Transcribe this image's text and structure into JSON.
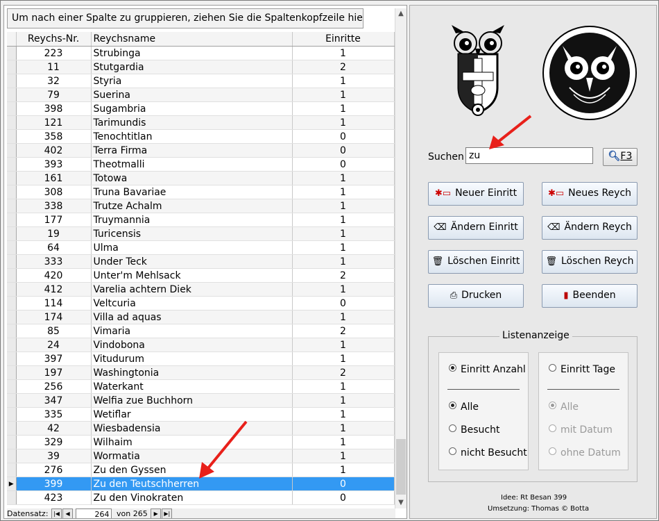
{
  "grid": {
    "group_bar_text": "Um nach einer Spalte zu gruppieren, ziehen Sie die Spaltenkopfzeile hierher.",
    "columns": [
      "Reychs-Nr.",
      "Reychsname",
      "Einritte"
    ],
    "rows": [
      {
        "nr": "223",
        "name": "Strubinga",
        "einritte": "1"
      },
      {
        "nr": "11",
        "name": "Stutgardia",
        "einritte": "2"
      },
      {
        "nr": "32",
        "name": "Styria",
        "einritte": "1"
      },
      {
        "nr": "79",
        "name": "Suerina",
        "einritte": "1"
      },
      {
        "nr": "398",
        "name": "Sugambria",
        "einritte": "1"
      },
      {
        "nr": "121",
        "name": "Tarimundis",
        "einritte": "1"
      },
      {
        "nr": "358",
        "name": "Tenochtitlan",
        "einritte": "0"
      },
      {
        "nr": "402",
        "name": "Terra Firma",
        "einritte": "0"
      },
      {
        "nr": "393",
        "name": "Theotmalli",
        "einritte": "0"
      },
      {
        "nr": "161",
        "name": "Totowa",
        "einritte": "1"
      },
      {
        "nr": "308",
        "name": "Truna Bavariae",
        "einritte": "1"
      },
      {
        "nr": "338",
        "name": "Trutze Achalm",
        "einritte": "1"
      },
      {
        "nr": "177",
        "name": "Truymannia",
        "einritte": "1"
      },
      {
        "nr": "19",
        "name": "Turicensis",
        "einritte": "1"
      },
      {
        "nr": "64",
        "name": "Ulma",
        "einritte": "1"
      },
      {
        "nr": "333",
        "name": "Under Teck",
        "einritte": "1"
      },
      {
        "nr": "420",
        "name": "Unter'm Mehlsack",
        "einritte": "2"
      },
      {
        "nr": "412",
        "name": "Varelia achtern Diek",
        "einritte": "1"
      },
      {
        "nr": "114",
        "name": "Veltcuria",
        "einritte": "0"
      },
      {
        "nr": "174",
        "name": "Villa ad aquas",
        "einritte": "1"
      },
      {
        "nr": "85",
        "name": "Vimaria",
        "einritte": "2"
      },
      {
        "nr": "24",
        "name": "Vindobona",
        "einritte": "1"
      },
      {
        "nr": "397",
        "name": "Vitudurum",
        "einritte": "1"
      },
      {
        "nr": "197",
        "name": "Washingtonia",
        "einritte": "2"
      },
      {
        "nr": "256",
        "name": "Waterkant",
        "einritte": "1"
      },
      {
        "nr": "347",
        "name": "Welfia zue Buchhorn",
        "einritte": "1"
      },
      {
        "nr": "335",
        "name": "Wetiflar",
        "einritte": "1"
      },
      {
        "nr": "42",
        "name": "Wiesbadensia",
        "einritte": "1"
      },
      {
        "nr": "329",
        "name": "Wilhaim",
        "einritte": "1"
      },
      {
        "nr": "39",
        "name": "Wormatia",
        "einritte": "1"
      },
      {
        "nr": "276",
        "name": "Zu den Gyssen",
        "einritte": "1"
      },
      {
        "nr": "399",
        "name": "Zu den Teutschherren",
        "einritte": "0",
        "current": true
      },
      {
        "nr": "423",
        "name": "Zu den Vinokraten",
        "einritte": "0"
      }
    ]
  },
  "navigator": {
    "label": "Datensatz:",
    "current_record": "264",
    "of_text": "von 265"
  },
  "search": {
    "label": "Suchen",
    "value": "zu",
    "button_label": "F3",
    "icon": "magnifier-icon"
  },
  "buttons": {
    "neuer_einritt": "Neuer Einritt",
    "neues_reych": "Neues Reych",
    "aendern_einritt": "Ändern Einritt",
    "aendern_reych": "Ändern Reych",
    "loeschen_einritt": "Löschen Einritt",
    "loeschen_reych": "Löschen Reych",
    "drucken": "Drucken",
    "beenden": "Beenden"
  },
  "listenanzeige": {
    "title": "Listenanzeige",
    "left": {
      "header_option": "Einritt Anzahl",
      "options": [
        "Alle",
        "Besucht",
        "nicht Besucht"
      ],
      "selected": "Alle"
    },
    "right": {
      "header_option": "Einritt Tage",
      "options": [
        "Alle",
        "mit Datum",
        "ohne Datum"
      ],
      "selected": "Alle",
      "disabled": true
    }
  },
  "footer": {
    "idee": "Idee: Rt Besan 399",
    "umsetzung": "Umsetzung: Thomas © Botta"
  },
  "colors": {
    "selection": "#3399f3",
    "annotation_arrow": "#e8201a"
  }
}
